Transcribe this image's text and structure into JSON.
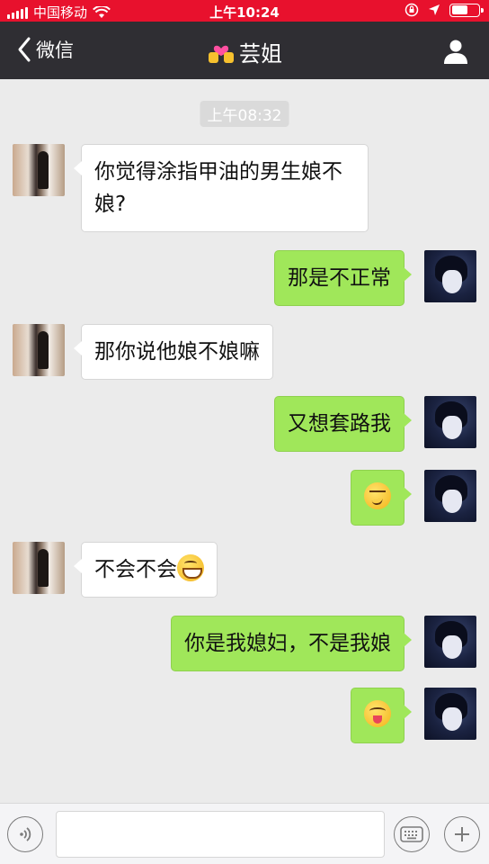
{
  "status_bar": {
    "carrier": "中国移动",
    "time": "上午10:24",
    "icons": [
      "signal-icon",
      "wifi-icon",
      "lock-rotation-icon",
      "location-icon",
      "battery-icon"
    ]
  },
  "nav": {
    "back_label": "微信",
    "title": "芸姐",
    "title_emoji": "couple-heart-icon",
    "right_icon": "person-icon"
  },
  "chat": {
    "timestamp": "上午08:32",
    "messages": [
      {
        "side": "left",
        "text": "你觉得涂指甲油的男生娘不娘?"
      },
      {
        "side": "right",
        "text": "那是不正常"
      },
      {
        "side": "left",
        "text": "那你说他娘不娘嘛"
      },
      {
        "side": "right",
        "text": "又想套路我"
      },
      {
        "side": "right",
        "text": "",
        "emoji": "smirk-emoji"
      },
      {
        "side": "left",
        "text": "不会不会",
        "emoji": "grin-emoji"
      },
      {
        "side": "right",
        "text": "你是我媳妇，不是我娘"
      },
      {
        "side": "right",
        "text": "",
        "emoji": "tongue-wink-emoji"
      }
    ]
  },
  "input_bar": {
    "value": "",
    "placeholder": ""
  },
  "colors": {
    "status_bar": "#e8112d",
    "nav_bar": "#2f2e33",
    "chat_bg": "#ebebeb",
    "bubble_sent": "#a0e75a",
    "bubble_received": "#ffffff"
  }
}
